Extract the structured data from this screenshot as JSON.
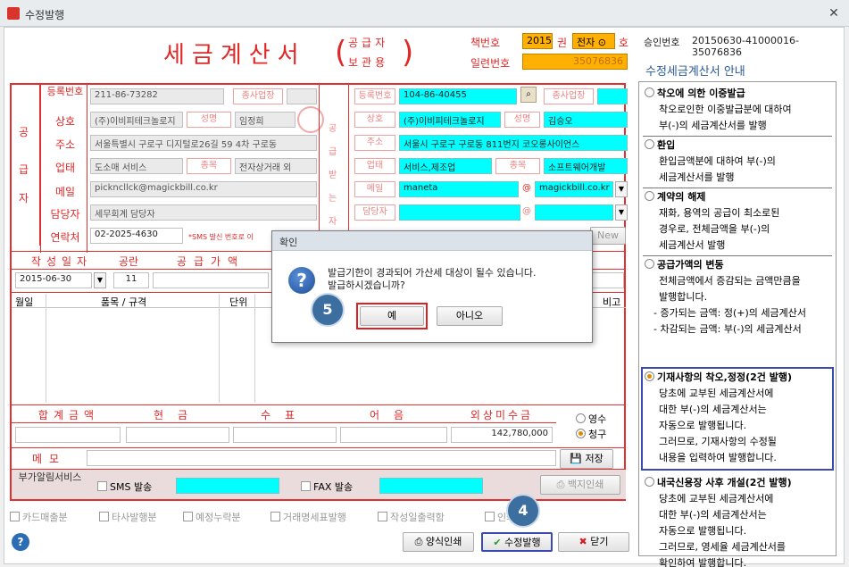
{
  "window": {
    "title": "수정발행"
  },
  "header": {
    "title": "세금계산서",
    "bracket_top": "공급자",
    "bracket_bottom": "보관용",
    "book_label": "책번호",
    "book_year": "2015",
    "book_unit": "권",
    "book_type": "전자",
    "book_ho": "호",
    "serial_label": "일련번호",
    "serial_value": "35076836",
    "approval_label": "승인번호",
    "approval_value": "20150630-41000016-35076836"
  },
  "supplier": {
    "side_label": [
      "공",
      "급",
      "자"
    ],
    "rows": [
      {
        "label": "등록번호",
        "value": "211-86-73282"
      },
      {
        "label": "상호",
        "value": "(주)이비피테크놀로지"
      },
      {
        "label": "주소",
        "value": "서울특별시 구로구 디지털로26길 59 4차 구로동"
      },
      {
        "label": "업태",
        "value": "도소매 서비스"
      },
      {
        "label": "메일",
        "value": "pickncllck@magickbill.co.kr"
      },
      {
        "label": "담당자",
        "value": "세무회계 담당자"
      },
      {
        "label": "연락처",
        "value": "02-2025-4630"
      }
    ],
    "sub_label_1": "종사업장",
    "sub_label_2": "성명",
    "sub_value_2": "임정희",
    "sub_label_3": "종목",
    "sub_value_3": "전자상거래 외",
    "sms_note": "*SMS 발신 번호로 이"
  },
  "buyer": {
    "side_label": [
      "공",
      "급",
      "받",
      "는",
      "자"
    ],
    "rows": [
      {
        "label": "등록번호",
        "value": "104-86-40455"
      },
      {
        "label": "상호",
        "value": "(주)이비피테크놀로지"
      },
      {
        "label": "주소",
        "value": "서울시 구로구 구로동 811번지 코오롱사이언스"
      },
      {
        "label": "업태",
        "value": "서비스,제조업"
      },
      {
        "label": "메일",
        "value": "maneta"
      }
    ],
    "sub_label_1": "종사업장",
    "sub_label_2": "성명",
    "sub_value_2": "김승오",
    "sub_label_3": "종목",
    "sub_value_3": "소프트웨어개발",
    "mail_domain": "magickbill.co.kr",
    "contact_label": "담당자",
    "new_button": "New"
  },
  "summary": {
    "date_label": "작성일자",
    "date_value": "2015-06-30",
    "blank_label": "공란",
    "blank_value": "11",
    "supply_label": "공급가액"
  },
  "items": {
    "headers": [
      "월일",
      "품목 / 규격",
      "단위",
      "비고"
    ]
  },
  "totals": {
    "headers": [
      "합계금액",
      "현금",
      "수표",
      "어음",
      "외상미수금"
    ],
    "outstanding_value": "142,780,000",
    "radio_receipt": "영수",
    "radio_claim": "청구"
  },
  "memo": {
    "label": "메모",
    "save_button": "저장"
  },
  "alarm": {
    "label": "부가알림서비스",
    "sms_label": "SMS 발송",
    "fax_label": "FAX 발송",
    "print_button": "백지인쇄"
  },
  "options": [
    "카드매출분",
    "타사발행분",
    "예정누락분",
    "거래명세표발행",
    "작성일출력함",
    "인쇄함"
  ],
  "footer": {
    "help_icon": "?",
    "form_print_button": "양식인쇄",
    "issue_button": "수정발행",
    "close_button": "닫기"
  },
  "side_panel": {
    "title": "수정세금계산서 안내",
    "items": [
      {
        "head": "착오에 의한 이중발급",
        "lines": [
          "착오로인한 이중발급분에 대하여",
          "부(-)의 세금계산서를 발행"
        ]
      },
      {
        "head": "환입",
        "lines": [
          "환입금액분에 대하여 부(-)의",
          "세금계산서를 발행"
        ]
      },
      {
        "head": "계약의 해제",
        "lines": [
          "재화, 용역의 공급이 최소로된",
          "경우로, 전체금액을 부(-)의",
          "세금계산서 발행"
        ]
      },
      {
        "head": "공급가액의 변동",
        "lines": [
          "전체금액에서 증감되는 금액만큼을",
          "발행합니다.",
          "- 증가되는 금액: 정(+)의 세금계산서",
          "- 차감되는 금액: 부(-)의 세금계산서"
        ]
      },
      {
        "head": "기재사항의 착오,정정(2건 발행)",
        "lines": [
          "당초에 교부된 세금계산서에",
          "대한 부(-)의 세금계산서는",
          "자동으로 발행됩니다.",
          "그러므로, 기재사항의 수정될",
          "내용을 입력하여 발행합니다."
        ]
      },
      {
        "head": "내국신용장 사후 개설(2건 발행)",
        "lines": [
          "당초에 교부된 세금계산서에",
          "대한 부(-)의 세금계산서는",
          "자동으로 발행됩니다.",
          "그러므로, 영세율 세금계산서를",
          "확인하여 발행합니다."
        ]
      }
    ]
  },
  "dialog": {
    "title": "확인",
    "message_line1": "발급기한이 경과되어 가산세 대상이 될수 있습니다.",
    "message_line2": "발급하시겠습니까?",
    "yes_button": "예",
    "no_button": "아니오"
  },
  "steps": {
    "step4": "4",
    "step5": "5"
  }
}
